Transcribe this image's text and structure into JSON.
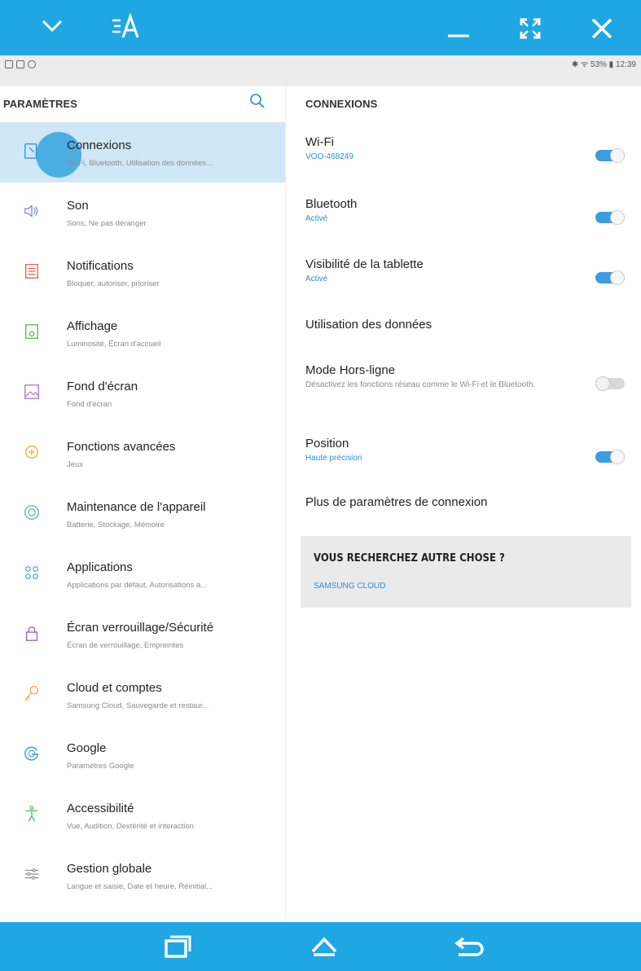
{
  "window": {
    "title_icon": "font-size-icon",
    "accent": "#1fa7e3"
  },
  "status": {
    "right": "✱ ᯤ 53% ▮ 12:39"
  },
  "left": {
    "title": "PARAMÈTRES",
    "items": [
      {
        "title": "Connexions",
        "sub": "Wi-Fi, Bluetooth, Utilisation des données...",
        "icon": "connections-icon",
        "active": true
      },
      {
        "title": "Son",
        "sub": "Sons, Ne pas déranger",
        "icon": "sound-icon"
      },
      {
        "title": "Notifications",
        "sub": "Bloquer, autoriser, prioriser",
        "icon": "notifications-icon"
      },
      {
        "title": "Affichage",
        "sub": "Luminosité, Écran d'accueil",
        "icon": "display-icon"
      },
      {
        "title": "Fond d'écran",
        "sub": "Fond d'écran",
        "icon": "wallpaper-icon"
      },
      {
        "title": "Fonctions avancées",
        "sub": "Jeux",
        "icon": "advanced-features-icon"
      },
      {
        "title": "Maintenance de l'appareil",
        "sub": "Batterie, Stockage, Mémoire",
        "icon": "device-maintenance-icon"
      },
      {
        "title": "Applications",
        "sub": "Applications par défaut, Autorisations a...",
        "icon": "apps-icon"
      },
      {
        "title": "Écran verrouillage/Sécurité",
        "sub": "Écran de verrouillage, Empreintes",
        "icon": "lock-icon"
      },
      {
        "title": "Cloud et comptes",
        "sub": "Samsung Cloud, Sauvegarde et restaur...",
        "icon": "key-icon"
      },
      {
        "title": "Google",
        "sub": "Paramètres Google",
        "icon": "google-icon"
      },
      {
        "title": "Accessibilité",
        "sub": "Vue, Audition, Dextérité et interaction",
        "icon": "accessibility-icon"
      },
      {
        "title": "Gestion globale",
        "sub": "Langue et saisie, Date et heure, Réinitial...",
        "icon": "general-management-icon"
      }
    ]
  },
  "right": {
    "title": "CONNEXIONS",
    "items": [
      {
        "title": "Wi-Fi",
        "sub": "VOO-468249",
        "toggle": "on"
      },
      {
        "title": "Bluetooth",
        "sub": "Activé",
        "toggle": "on"
      },
      {
        "title": "Visibilité de la tablette",
        "sub": "Activé",
        "toggle": "on"
      },
      {
        "title": "Utilisation des données"
      },
      {
        "title": "Mode Hors-ligne",
        "sub": "Désactivez les fonctions réseau comme le Wi-Fi et le Bluetooth.",
        "toggle": "off"
      },
      {
        "title": "Position",
        "sub": "Haute précision",
        "toggle": "on"
      },
      {
        "title": "Plus de paramètres de connexion"
      }
    ],
    "suggest": {
      "title": "VOUS RECHERCHEZ AUTRE CHOSE ?",
      "link": "SAMSUNG CLOUD"
    }
  }
}
